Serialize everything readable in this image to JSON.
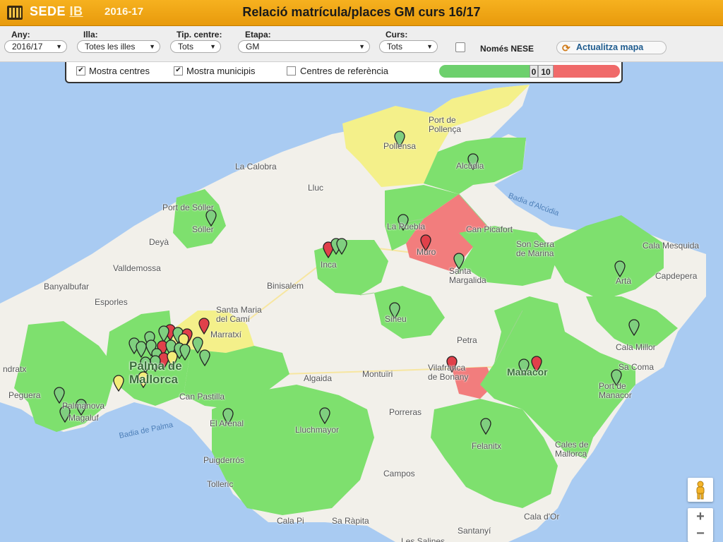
{
  "header": {
    "brand_sede": "SEDE",
    "brand_ib": "IB",
    "year": "2016-17",
    "title": "Relació matrícula/places GM curs 16/17",
    "logo_icon": "bars-shield-icon"
  },
  "filters": {
    "any": {
      "label": "Any:",
      "value": "2016/17"
    },
    "illa": {
      "label": "Illa:",
      "value": "Totes les illes"
    },
    "tip_centre": {
      "label": "Tip. centre:",
      "value": "Tots"
    },
    "etapa": {
      "label": "Etapa:",
      "value": "GM"
    },
    "curs": {
      "label": "Curs:",
      "value": "Tots"
    },
    "nese": {
      "label": "Només NESE",
      "checked": false
    },
    "refresh": {
      "label": "Actualitza mapa",
      "icon": "refresh-icon"
    }
  },
  "overlay": {
    "mostra_centres": {
      "label": "Mostra centres",
      "checked": true
    },
    "mostra_municipis": {
      "label": "Mostra municipis",
      "checked": true
    },
    "centres_referencia": {
      "label": "Centres de referència",
      "checked": false
    },
    "legend": {
      "low": "0",
      "high": "10",
      "low_color": "#6dd06d",
      "high_color": "#f06a6a"
    }
  },
  "map": {
    "colors": {
      "water": "#a9cbf2",
      "land": "#f2f0ea",
      "green": "#7ee06e",
      "yellow": "#f4f08a",
      "red": "#f27d7d"
    },
    "places": {
      "port_pollenca": "Port de\nPollença",
      "pollensa": "Pollensa",
      "la_calobra": "La Calobra",
      "alcudia": "Alcúdia",
      "lluc": "Lluc",
      "port_soller": "Port de Sóller",
      "soller": "Sóller",
      "badia_alcudia": "Badia d'Alcúdia",
      "sa_pobla": "La Puebla",
      "can_picafort": "Can Picafort",
      "deya": "Deyà",
      "muro": "Muro",
      "son_serra": "Son Serra\nde Marina",
      "cala_mesquida": "Cala Mesquida",
      "valldemossa": "Valldemossa",
      "inca": "Inca",
      "santa_margalida": "Santa\nMargalida",
      "arta": "Artà",
      "capdepera": "Capdepera",
      "banyalbufar": "Banyalbufar",
      "binisalem": "Binisalem",
      "esporles": "Esporles",
      "santa_maria": "Santa Maria\ndel Camí",
      "sineu": "Sineu",
      "marratxi": "Marratxí",
      "petra": "Petra",
      "cala_millor": "Cala Millor",
      "andratx": "ndratx",
      "palma": "Palma de\nMallorca",
      "montuiri": "Montuïri",
      "vilafranca": "Vilafranca\nde Bonany",
      "manacor": "Manacor",
      "sa_coma": "Sa Coma",
      "algaida": "Algaida",
      "porto_cristo": "Port de\nManacor",
      "peguera": "Peguera",
      "can_pastilla": "Can Pastilla",
      "porreras": "Porreras",
      "palmanova": "Palmanova",
      "magaluf": "Magaluf",
      "el_arenal": "El Arenal",
      "lluchmayor": "Lluchmayor",
      "badia_palma": "Badia de Palma",
      "felanitx": "Felanitx",
      "cales_mallorca": "Cales de\nMallorca",
      "puigderros": "Puigderrós",
      "campos": "Campos",
      "tolleric": "Tolleric",
      "cala_pi": "Cala Pi",
      "sa_rapita": "Sa Ràpita",
      "santanyi": "Santanyí",
      "cala_dor": "Cala d'Or",
      "ses_salines": "Les Salines"
    },
    "marker_counts": {
      "green": 40,
      "yellow": 8,
      "red": 10
    }
  },
  "controls": {
    "pegman_icon": "pegman-icon",
    "zoom_in": "+",
    "zoom_out": "−"
  }
}
